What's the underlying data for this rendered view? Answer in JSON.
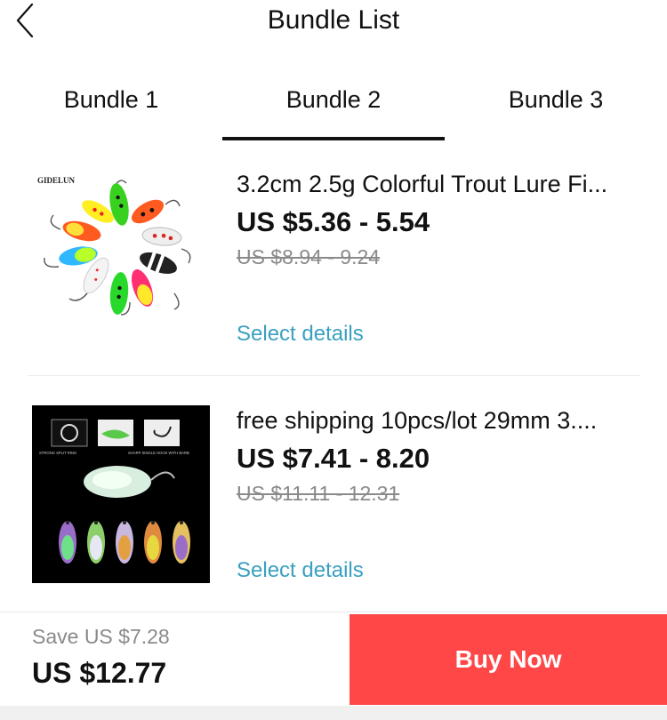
{
  "header": {
    "title": "Bundle List",
    "back_icon": "back-icon"
  },
  "tabs": [
    {
      "label": "Bundle 1"
    },
    {
      "label": "Bundle 2"
    },
    {
      "label": "Bundle 3"
    }
  ],
  "items": [
    {
      "title": "3.2cm 2.5g Colorful Trout Lure Fi...",
      "price": "US $5.36 - 5.54",
      "original_price": "US $8.94 - 9.24",
      "action": "Select details",
      "image_brand": "GIDELUN"
    },
    {
      "title": "free shipping 10pcs/lot 29mm 3....",
      "price": "US $7.41 - 8.20",
      "original_price": "US $11.11 - 12.31",
      "action": "Select details",
      "image_captions": [
        "STRONG SPLIT RING",
        "SHARP SINGLE HOOK WITH BARB"
      ]
    }
  ],
  "footer": {
    "save_text": "Save US $7.28",
    "total": "US $12.77",
    "buy_label": "Buy Now"
  },
  "colors": {
    "accent_red": "#ff4747",
    "link_blue": "#3aa0c0",
    "muted_gray": "#8a8a8a"
  }
}
